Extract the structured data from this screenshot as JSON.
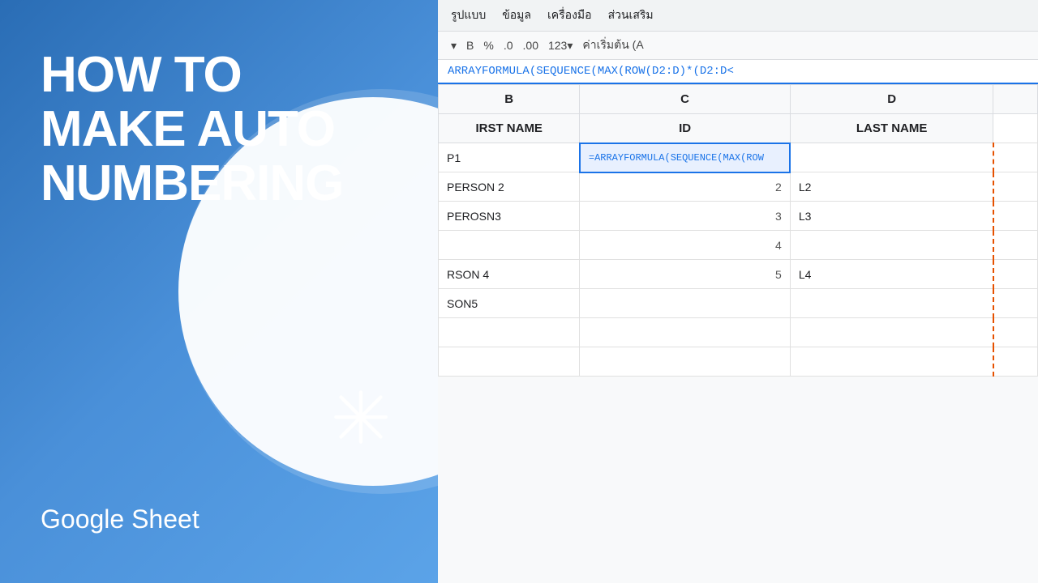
{
  "left": {
    "title_line1": "HOW TO",
    "title_line2": "MAKE AUTO",
    "title_line3": "NUMBERING",
    "subtitle": "Google Sheet"
  },
  "menu": {
    "items": [
      "รูปแบบ",
      "ข้อมูล",
      "เครื่องมือ",
      "ส่วนเสริม"
    ]
  },
  "toolbar": {
    "bold": "B",
    "percent": "%",
    "decimal_down": ".0",
    "decimal_up": ".00",
    "format_btn": "123▾",
    "default_label": "ค่าเริ่มต้น (A"
  },
  "formula_bar": {
    "formula": "ARRAYFORMULA(SEQUENCE(MAX(ROW(D2:D)*(D2:D<"
  },
  "columns": {
    "b_header": "B",
    "c_header": "C",
    "d_header": "D"
  },
  "rows": [
    {
      "col_b_label": "FIRST NAME",
      "col_b_text": "IRST NAME",
      "col_c_label": "ID",
      "col_d_label": "LAST NAME",
      "is_header": true
    },
    {
      "col_b": "P1",
      "col_c": "=ARRAYFORMULA(SEQUENCE(MAX(ROW",
      "col_d": "",
      "is_formula": true
    },
    {
      "col_b": "PERSON 2",
      "col_c": "2",
      "col_d": "L2",
      "is_formula": false
    },
    {
      "col_b": "PEROSN3",
      "col_c": "3",
      "col_d": "L3",
      "is_formula": false
    },
    {
      "col_b": "",
      "col_c": "4",
      "col_d": "",
      "is_formula": false
    },
    {
      "col_b": "RSON 4",
      "col_c": "5",
      "col_d": "L4",
      "is_formula": false
    },
    {
      "col_b": "SON5",
      "col_c": "",
      "col_d": "",
      "is_formula": false
    },
    {
      "col_b": "",
      "col_c": "",
      "col_d": "",
      "is_formula": false
    },
    {
      "col_b": "",
      "col_c": "",
      "col_d": "",
      "is_formula": false
    }
  ]
}
